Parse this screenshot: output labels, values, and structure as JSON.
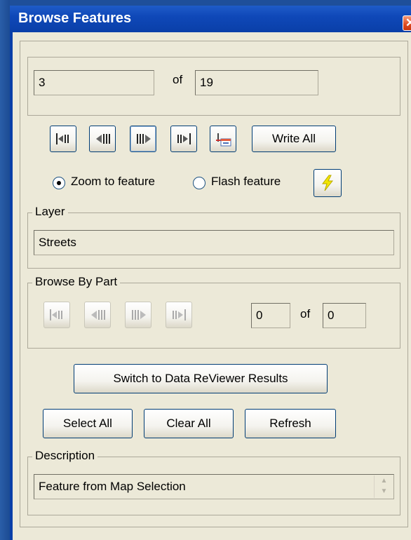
{
  "window": {
    "title": "Browse Features",
    "close_glyph": "✕"
  },
  "record": {
    "current": "3",
    "of_label": "of",
    "total": "19"
  },
  "toolbar": {
    "first_icon": "first-feature-icon",
    "prev_icon": "previous-feature-icon",
    "next_icon": "next-feature-icon",
    "last_icon": "last-feature-icon",
    "write_icon": "write-record-icon",
    "write_all_label": "Write All"
  },
  "options": {
    "zoom_label": "Zoom to feature",
    "flash_label": "Flash feature",
    "selected": "zoom",
    "lightning_icon": "lightning-icon"
  },
  "layer": {
    "group_title": "Layer",
    "value": "Streets"
  },
  "browse_by_part": {
    "group_title": "Browse By Part",
    "current": "0",
    "of_label": "of",
    "total": "0"
  },
  "actions": {
    "switch_label": "Switch to Data ReViewer Results",
    "select_all_label": "Select All",
    "clear_all_label": "Clear All",
    "refresh_label": "Refresh"
  },
  "description": {
    "group_title": "Description",
    "value": "Feature from Map Selection"
  },
  "colors": {
    "titlebar": "#0a3fa8",
    "panel": "#ece9d8",
    "accent_close": "#dd4a1f",
    "lightning": "#f2e600"
  }
}
